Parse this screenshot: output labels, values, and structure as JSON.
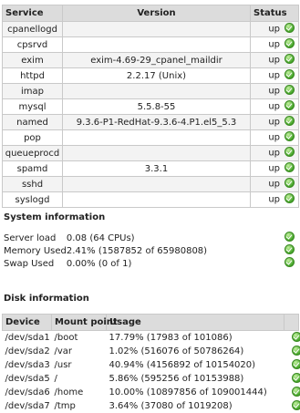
{
  "services": {
    "headers": {
      "service": "Service",
      "version": "Version",
      "status": "Status"
    },
    "rows": [
      {
        "name": "cpanellogd",
        "version": "",
        "status": "up"
      },
      {
        "name": "cpsrvd",
        "version": "",
        "status": "up"
      },
      {
        "name": "exim",
        "version": "exim-4.69-29_cpanel_maildir",
        "status": "up"
      },
      {
        "name": "httpd",
        "version": "2.2.17 (Unix)",
        "status": "up"
      },
      {
        "name": "imap",
        "version": "",
        "status": "up"
      },
      {
        "name": "mysql",
        "version": "5.5.8-55",
        "status": "up"
      },
      {
        "name": "named",
        "version": "9.3.6-P1-RedHat-9.3.6-4.P1.el5_5.3",
        "status": "up"
      },
      {
        "name": "pop",
        "version": "",
        "status": "up"
      },
      {
        "name": "queueprocd",
        "version": "",
        "status": "up"
      },
      {
        "name": "spamd",
        "version": "3.3.1",
        "status": "up"
      },
      {
        "name": "sshd",
        "version": "",
        "status": "up"
      },
      {
        "name": "syslogd",
        "version": "",
        "status": "up"
      }
    ]
  },
  "system": {
    "title": "System information",
    "rows": [
      {
        "label": "Server load",
        "value": "0.08 (64 CPUs)"
      },
      {
        "label": "Memory Used",
        "value": "2.41% (1587852 of 65980808)"
      },
      {
        "label": "Swap Used",
        "value": "0.00% (0 of 1)"
      }
    ]
  },
  "disk": {
    "title": "Disk information",
    "headers": {
      "device": "Device",
      "mount": "Mount point",
      "usage": "Usage"
    },
    "rows": [
      {
        "device": "/dev/sda1",
        "mount": "/boot",
        "usage": "17.79% (17983 of 101086)"
      },
      {
        "device": "/dev/sda2",
        "mount": "/var",
        "usage": "1.02% (516076 of 50786264)"
      },
      {
        "device": "/dev/sda3",
        "mount": "/usr",
        "usage": "40.94% (4156892 of 10154020)"
      },
      {
        "device": "/dev/sda5",
        "mount": "/",
        "usage": "5.86% (595256 of 10153988)"
      },
      {
        "device": "/dev/sda6",
        "mount": "/home",
        "usage": "10.00% (10897856 of 109001444)"
      },
      {
        "device": "/dev/sda7",
        "mount": "/tmp",
        "usage": "3.64% (37080 of 1019208)"
      }
    ]
  },
  "icons": {
    "status_ok": "green-check-circle-icon"
  },
  "colors": {
    "header_bg": "#dcdcdc",
    "ok_green": "#45a52a",
    "border": "#c9c9c9"
  }
}
